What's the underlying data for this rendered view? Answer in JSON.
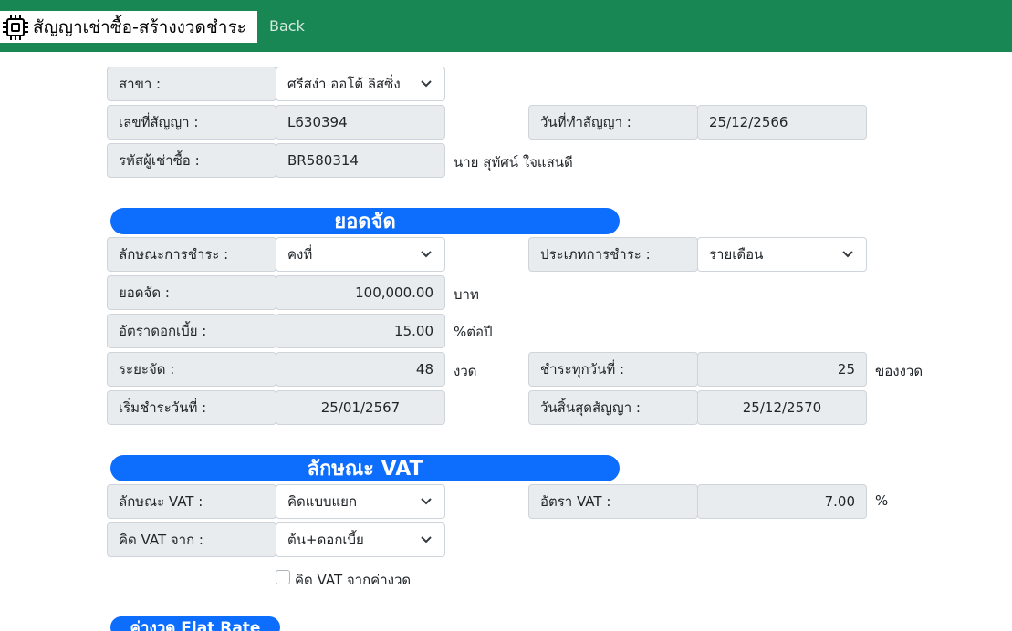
{
  "header": {
    "title": "สัญญาเช่าซื้อ-สร้างงวดชำระ",
    "back_label": "Back",
    "brand_icon": "chip-icon"
  },
  "contract": {
    "branch_label": "สาขา :",
    "branch_value": "ศรีสง่า ออโต้ ลิสซิ่ง",
    "contract_no_label": "เลขที่สัญญา :",
    "contract_no_value": "L630394",
    "contract_date_label": "วันที่ทำสัญญา :",
    "contract_date_value": "25/12/2566",
    "customer_code_label": "รหัสผู้เช่าซื้อ :",
    "customer_code_value": "BR580314",
    "customer_name": "นาย สุทัศน์ ใจแสนดี"
  },
  "financing": {
    "header": "ยอดจัด",
    "payment_nature_label": "ลักษณะการชำระ :",
    "payment_nature_value": "คงที่",
    "payment_type_label": "ประเภทการชำระ :",
    "payment_type_value": "รายเดือน",
    "amount_label": "ยอดจัด :",
    "amount_value": "100,000.00",
    "amount_unit": "บาท",
    "interest_label": "อัตราดอกเบี้ย :",
    "interest_value": "15.00",
    "interest_unit": "%ต่อปี",
    "term_label": "ระยะจัด :",
    "term_value": "48",
    "term_unit": "งวด",
    "pay_day_label": "ชำระทุกวันที่ :",
    "pay_day_value": "25",
    "pay_day_unit": "ของงวด",
    "start_label": "เริ่มชำระวันที่ :",
    "start_value": "25/01/2567",
    "end_label": "วันสิ้นสุดสัญญา :",
    "end_value": "25/12/2570"
  },
  "vat": {
    "header": "ลักษณะ VAT",
    "nature_label": "ลักษณะ VAT :",
    "nature_value": "คิดแบบแยก",
    "rate_label": "อัตรา VAT :",
    "rate_value": "7.00",
    "rate_unit": "%",
    "from_label": "คิด VAT จาก :",
    "from_value": "ต้น+ดอกเบี้ย",
    "checkbox_label": "คิด VAT จากค่างวด",
    "checkbox_checked": false
  },
  "flat_rate": {
    "header": "ค่างวด Flat Rate"
  },
  "colors": {
    "topbar": "#198754",
    "section": "#0d6efd",
    "readonly": "#e9ecef"
  }
}
